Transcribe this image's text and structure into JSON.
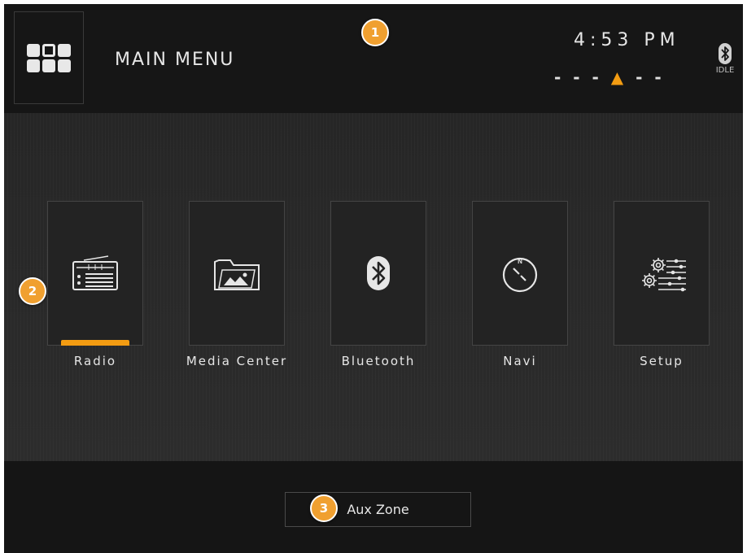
{
  "header": {
    "title": "MAIN MENU",
    "clock": "4:53 PM",
    "compass_left": "- - -",
    "compass_arrow": "▲",
    "compass_right": "- -",
    "bt_status": "IDLE"
  },
  "tiles": [
    {
      "label": "Radio",
      "icon": "radio-icon",
      "active": true
    },
    {
      "label": "Media Center",
      "icon": "folder-image-icon",
      "active": false
    },
    {
      "label": "Bluetooth",
      "icon": "bluetooth-icon",
      "active": false
    },
    {
      "label": "Navi",
      "icon": "compass-icon",
      "active": false
    },
    {
      "label": "Setup",
      "icon": "settings-sliders-icon",
      "active": false
    }
  ],
  "footer": {
    "aux_label": "Aux Zone"
  },
  "callouts": [
    "1",
    "2",
    "3"
  ],
  "colors": {
    "accent": "#f39c12",
    "callout": "#f0a030",
    "background": "#1a1a1a"
  }
}
